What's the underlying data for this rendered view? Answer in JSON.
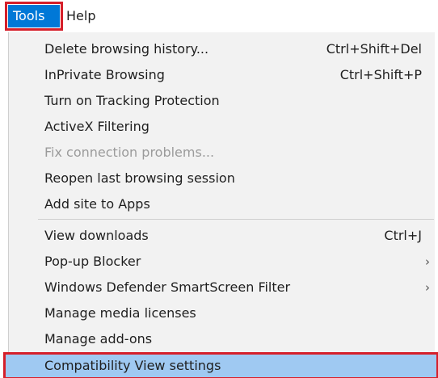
{
  "menubar": {
    "tools_label": "Tools",
    "help_label": "Help"
  },
  "menu": {
    "items": [
      {
        "label": "Delete browsing history...",
        "shortcut": "Ctrl+Shift+Del"
      },
      {
        "label": "InPrivate Browsing",
        "shortcut": "Ctrl+Shift+P"
      },
      {
        "label": "Turn on Tracking Protection"
      },
      {
        "label": "ActiveX Filtering"
      },
      {
        "label": "Fix connection problems..."
      },
      {
        "label": "Reopen last browsing session"
      },
      {
        "label": "Add site to Apps"
      },
      {
        "label": "View downloads",
        "shortcut": "Ctrl+J"
      },
      {
        "label": "Pop-up Blocker"
      },
      {
        "label": "Windows Defender SmartScreen Filter"
      },
      {
        "label": "Manage media licenses"
      },
      {
        "label": "Manage add-ons"
      },
      {
        "label": "Compatibility View settings"
      }
    ]
  },
  "colors": {
    "menubar_selected": "#0078d7",
    "highlight_row": "#9fc9f2",
    "annotation_border": "#d51f2a",
    "disabled_text": "#9b9b9b"
  }
}
